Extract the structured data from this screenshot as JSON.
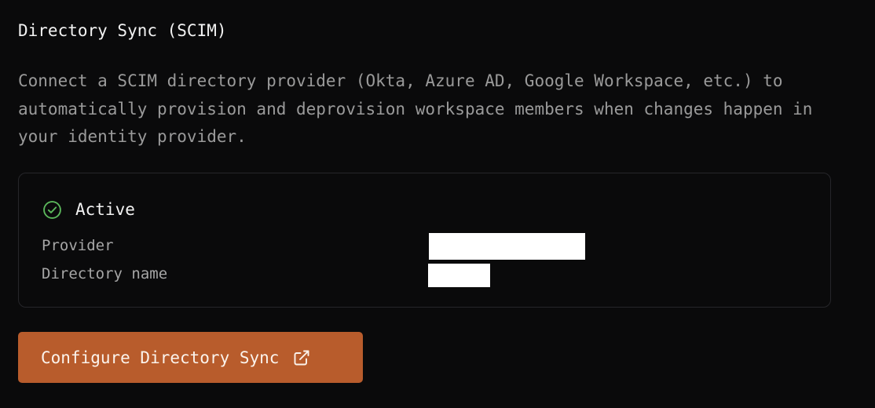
{
  "section": {
    "title": "Directory Sync (SCIM)",
    "description": "Connect a SCIM directory provider (Okta, Azure AD, Google Workspace, etc.) to automatically provision and deprovision workspace members when changes happen in your identity provider."
  },
  "status_card": {
    "status_label": "Active",
    "status_icon": "check-circle-icon",
    "status_color": "#5cb85c",
    "fields": [
      {
        "label": "Provider",
        "value": ""
      },
      {
        "label": "Directory name",
        "value": ""
      }
    ]
  },
  "actions": {
    "configure_label": "Configure Directory Sync",
    "configure_icon": "external-link-icon",
    "accent_color": "#b85c2c"
  }
}
